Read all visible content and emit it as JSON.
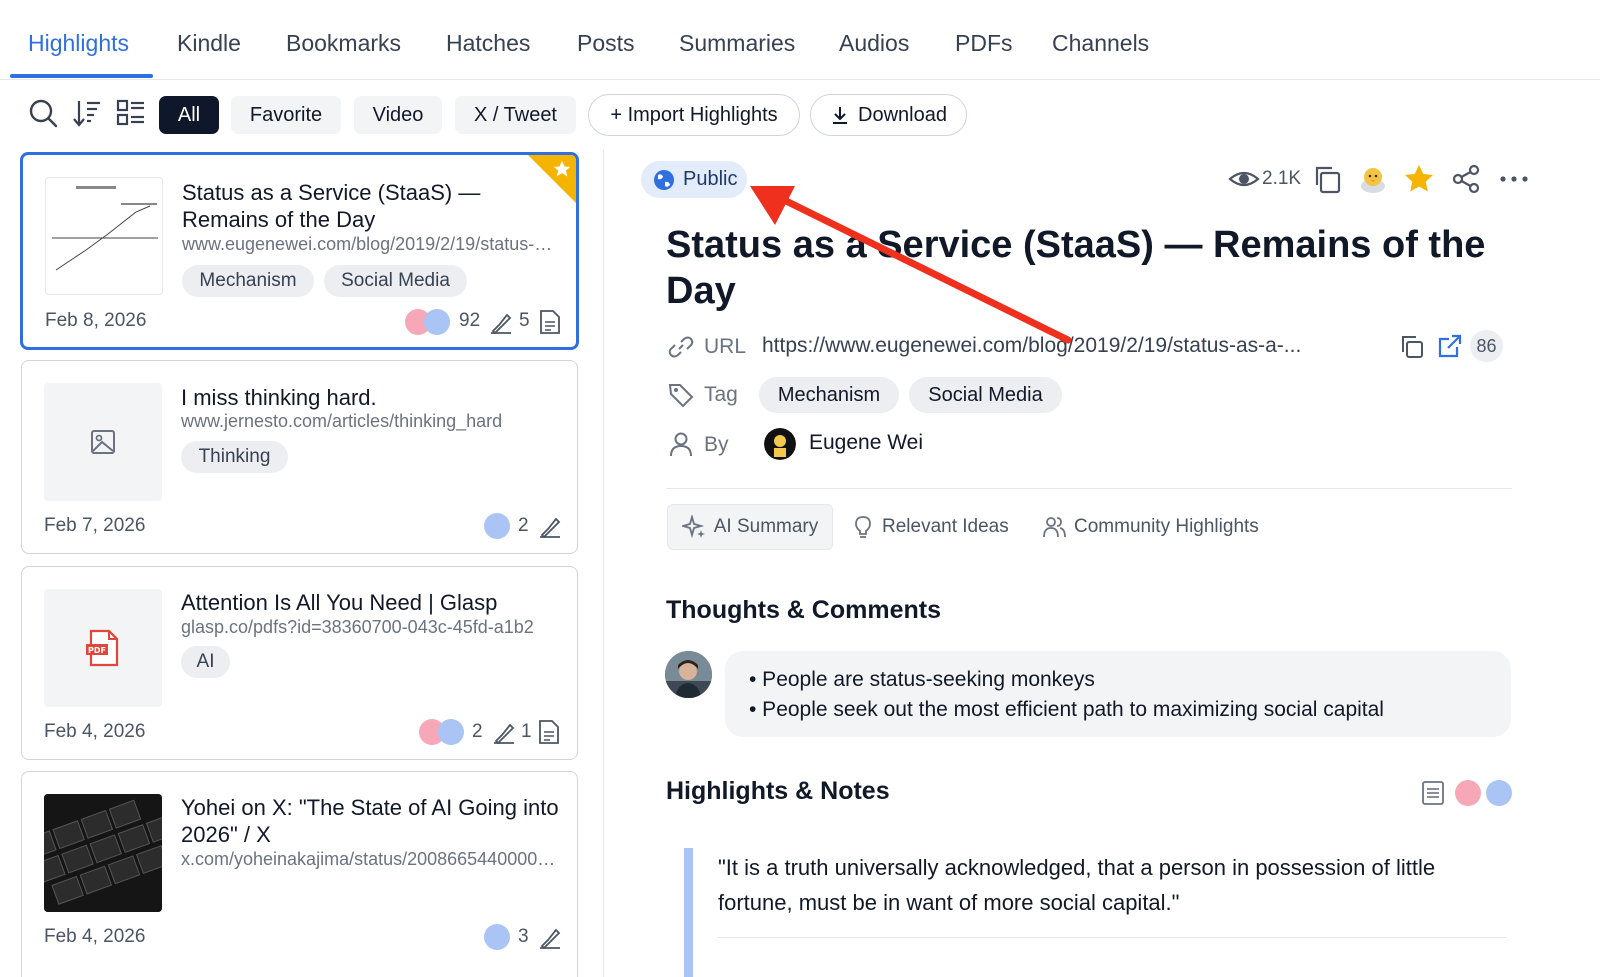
{
  "nav": {
    "tabs": [
      {
        "label": "Highlights",
        "active": true
      },
      {
        "label": "Kindle"
      },
      {
        "label": "Bookmarks"
      },
      {
        "label": "Hatches"
      },
      {
        "label": "Posts"
      },
      {
        "label": "Summaries"
      },
      {
        "label": "Audios"
      },
      {
        "label": "PDFs"
      },
      {
        "label": "Channels"
      }
    ]
  },
  "toolbar": {
    "icons": [
      "search-icon",
      "sort-icon",
      "layout-icon"
    ],
    "filters": [
      {
        "label": "All",
        "active": true
      },
      {
        "label": "Favorite"
      },
      {
        "label": "Video"
      },
      {
        "label": "X / Tweet"
      }
    ],
    "import_label": "+ Import Highlights",
    "download_label": "Download"
  },
  "cards": [
    {
      "title": "Status as a Service (StaaS) — Remains of the Day",
      "url": "www.eugenewei.com/blog/2019/2/19/status-as-a-service",
      "tags": [
        "Mechanism",
        "Social Media"
      ],
      "date": "Feb 8, 2026",
      "highlights": "92",
      "notes": "5",
      "favorite": true,
      "selected": true,
      "thumb": "chart-thumbnail"
    },
    {
      "title": "I miss thinking hard.",
      "url": "www.jernesto.com/articles/thinking_hard",
      "tags": [
        "Thinking"
      ],
      "date": "Feb 7, 2026",
      "highlights": "2",
      "thumb": "image-placeholder-icon"
    },
    {
      "title": "Attention Is All You Need | Glasp",
      "url": "glasp.co/pdfs?id=38360700-043c-45fd-a1b2",
      "tags": [
        "AI"
      ],
      "date": "Feb 4, 2026",
      "highlights": "2",
      "notes": "1",
      "thumb": "pdf-icon"
    },
    {
      "title": "Yohei on X: \"The State of AI Going into 2026\" / X",
      "url": "x.com/yoheinakajima/status/2008665440000000000",
      "tags": [],
      "date": "Feb 4, 2026",
      "highlights": "3",
      "thumb": "keyboard-photo"
    }
  ],
  "detail": {
    "visibility": "Public",
    "views": "2.1K",
    "title": "Status as a Service (StaaS) — Remains of the Day",
    "url_label": "URL",
    "url": "https://www.eugenewei.com/blog/2019/2/19/status-as-a-...",
    "url_count": "86",
    "tag_label": "Tag",
    "tags": [
      "Mechanism",
      "Social Media"
    ],
    "by_label": "By",
    "author": "Eugene Wei",
    "subtabs": [
      {
        "label": "AI Summary",
        "icon": "sparkle-icon",
        "active": true
      },
      {
        "label": "Relevant Ideas",
        "icon": "lightbulb-icon"
      },
      {
        "label": "Community Highlights",
        "icon": "users-icon"
      }
    ],
    "thoughts_title": "Thoughts & Comments",
    "comments": [
      "• People are status-seeking monkeys",
      "• People seek out the most efficient path to maximizing social capital"
    ],
    "highlights_title": "Highlights & Notes",
    "quote": "\"It is a truth universally acknowledged, that a person in possession of little fortune, must be in want of more social capital.\""
  },
  "colors": {
    "accent": "#2f6fe0",
    "favorite": "#f5b400",
    "dot_pink": "#f7a8b8",
    "dot_blue": "#a9c4f5",
    "annotation_arrow": "#f0301e"
  }
}
